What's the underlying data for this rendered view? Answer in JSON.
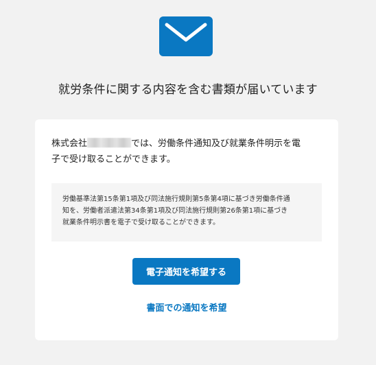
{
  "header": {
    "icon": "mail-icon",
    "icon_color": "#0a78c2",
    "title": "就労条件に関する内容を含む書類が届いています"
  },
  "card": {
    "intro_prefix": "株式会社",
    "intro_suffix_line1": "では、労働条件通知及び就業条件明示を電",
    "intro_line2": "子で受け取ることができます。",
    "legal_lines": [
      "労働基準法第15条第1項及び同法施行規則第5条第4項に基づき労働条件通",
      "知を、労働者派遣法第34条第1項及び同法施行規則第26条第1項に基づき",
      "就業条件明示書を電子で受け取ることができます。"
    ],
    "primary_button": "電子通知を希望する",
    "secondary_link": "書面での通知を希望"
  },
  "colors": {
    "accent": "#0a78c2",
    "background": "#f2f2f2",
    "card": "#ffffff",
    "legal_box": "#f5f5f5"
  }
}
